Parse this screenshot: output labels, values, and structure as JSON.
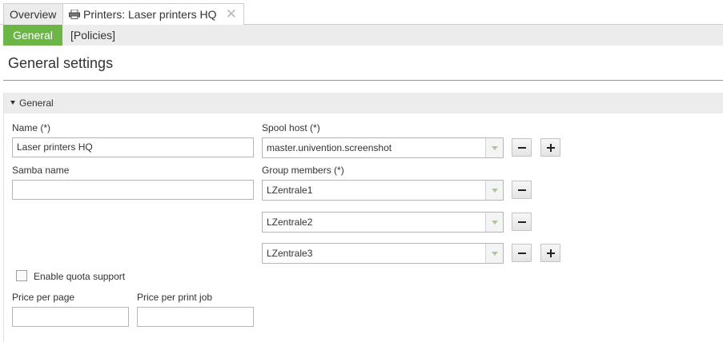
{
  "tabs": [
    {
      "label": "Overview"
    },
    {
      "label": "Printers: Laser printers HQ",
      "icon": "printer-icon",
      "close": "✕"
    }
  ],
  "subtabs": [
    {
      "label": "General"
    },
    {
      "label": "[Policies]"
    }
  ],
  "page_title": "General settings",
  "section": {
    "title": "General"
  },
  "form": {
    "name_label": "Name (*)",
    "name_value": "Laser printers HQ",
    "samba_label": "Samba name",
    "samba_value": "",
    "spool_label": "Spool host (*)",
    "spool_value": "master.univention.screenshot",
    "group_label": "Group members (*)",
    "group_members": [
      "LZentrale1",
      "LZentrale2",
      "LZentrale3"
    ],
    "quota_label": "Enable quota support",
    "quota_checked": false,
    "price_page_label": "Price per page",
    "price_page_value": "",
    "price_job_label": "Price per print job",
    "price_job_value": ""
  },
  "colors": {
    "accent": "#6cb645",
    "tab_bg": "#ececec"
  }
}
